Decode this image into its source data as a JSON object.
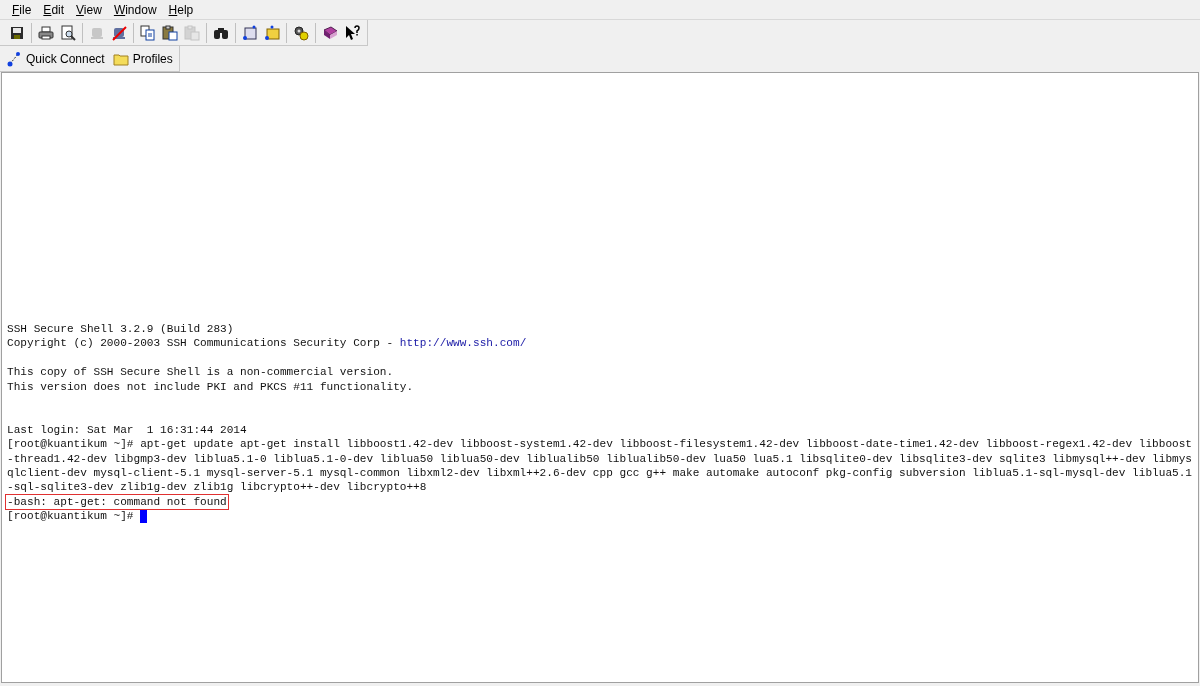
{
  "menu": [
    "File",
    "Edit",
    "View",
    "Window",
    "Help"
  ],
  "toolbar": [
    [
      {
        "disabled": false
      }
    ],
    [
      {
        "disabled": false
      },
      {
        "disabled": false
      }
    ],
    [
      {
        "disabled": true
      },
      {
        "disabled": false
      }
    ],
    [
      {
        "disabled": false
      },
      {
        "disabled": false
      },
      {
        "disabled": true
      }
    ],
    [
      {
        "disabled": false
      }
    ],
    [
      {
        "disabled": false
      },
      {
        "disabled": false
      }
    ],
    [
      {
        "disabled": false
      }
    ],
    [
      {
        "disabled": false
      },
      {
        "disabled": false
      }
    ]
  ],
  "profile_bar": [
    {
      "label": "Quick Connect"
    },
    {
      "label": "Profiles"
    }
  ],
  "terminal": {
    "lines": [
      {
        "kind": "text",
        "text": "SSH Secure Shell 3.2.9 (Build 283)"
      },
      {
        "kind": "link",
        "text": "Copyright (c) 2000-2003 SSH Communications Security Corp - ",
        "link": "http://www.ssh.com/"
      },
      {
        "kind": "blank"
      },
      {
        "kind": "text",
        "text": "This copy of SSH Secure Shell is a non-commercial version."
      },
      {
        "kind": "text",
        "text": "This version does not include PKI and PKCS #11 functionality."
      },
      {
        "kind": "blank"
      },
      {
        "kind": "blank"
      },
      {
        "kind": "text",
        "text": "Last login: Sat Mar  1 16:31:44 2014"
      },
      {
        "kind": "text",
        "text": "[root@kuantikum ~]# apt-get update apt-get install libboost1.42-dev libboost-system1.42-dev libboost-filesystem1.42-dev libboost-date-time1.42-dev libboost-regex1.42-dev libboost"
      },
      {
        "kind": "text",
        "text": "-thread1.42-dev libgmp3-dev liblua5.1-0 liblua5.1-0-dev liblua50 liblua50-dev liblualib50 liblualib50-dev lua50 lua5.1 libsqlite0-dev libsqlite3-dev sqlite3 libmysql++-dev libmys"
      },
      {
        "kind": "text",
        "text": "qlclient-dev mysql-client-5.1 mysql-server-5.1 mysql-common libxml2-dev libxml++2.6-dev cpp gcc g++ make automake autoconf pkg-config subversion liblua5.1-sql-mysql-dev liblua5.1"
      },
      {
        "kind": "text",
        "text": "-sql-sqlite3-dev zlib1g-dev zlib1g libcrypto++-dev libcrypto++8"
      },
      {
        "kind": "highlighted",
        "text": "-bash: apt-get: command not found"
      },
      {
        "kind": "prompt",
        "text": "[root@kuantikum ~]# "
      }
    ]
  }
}
